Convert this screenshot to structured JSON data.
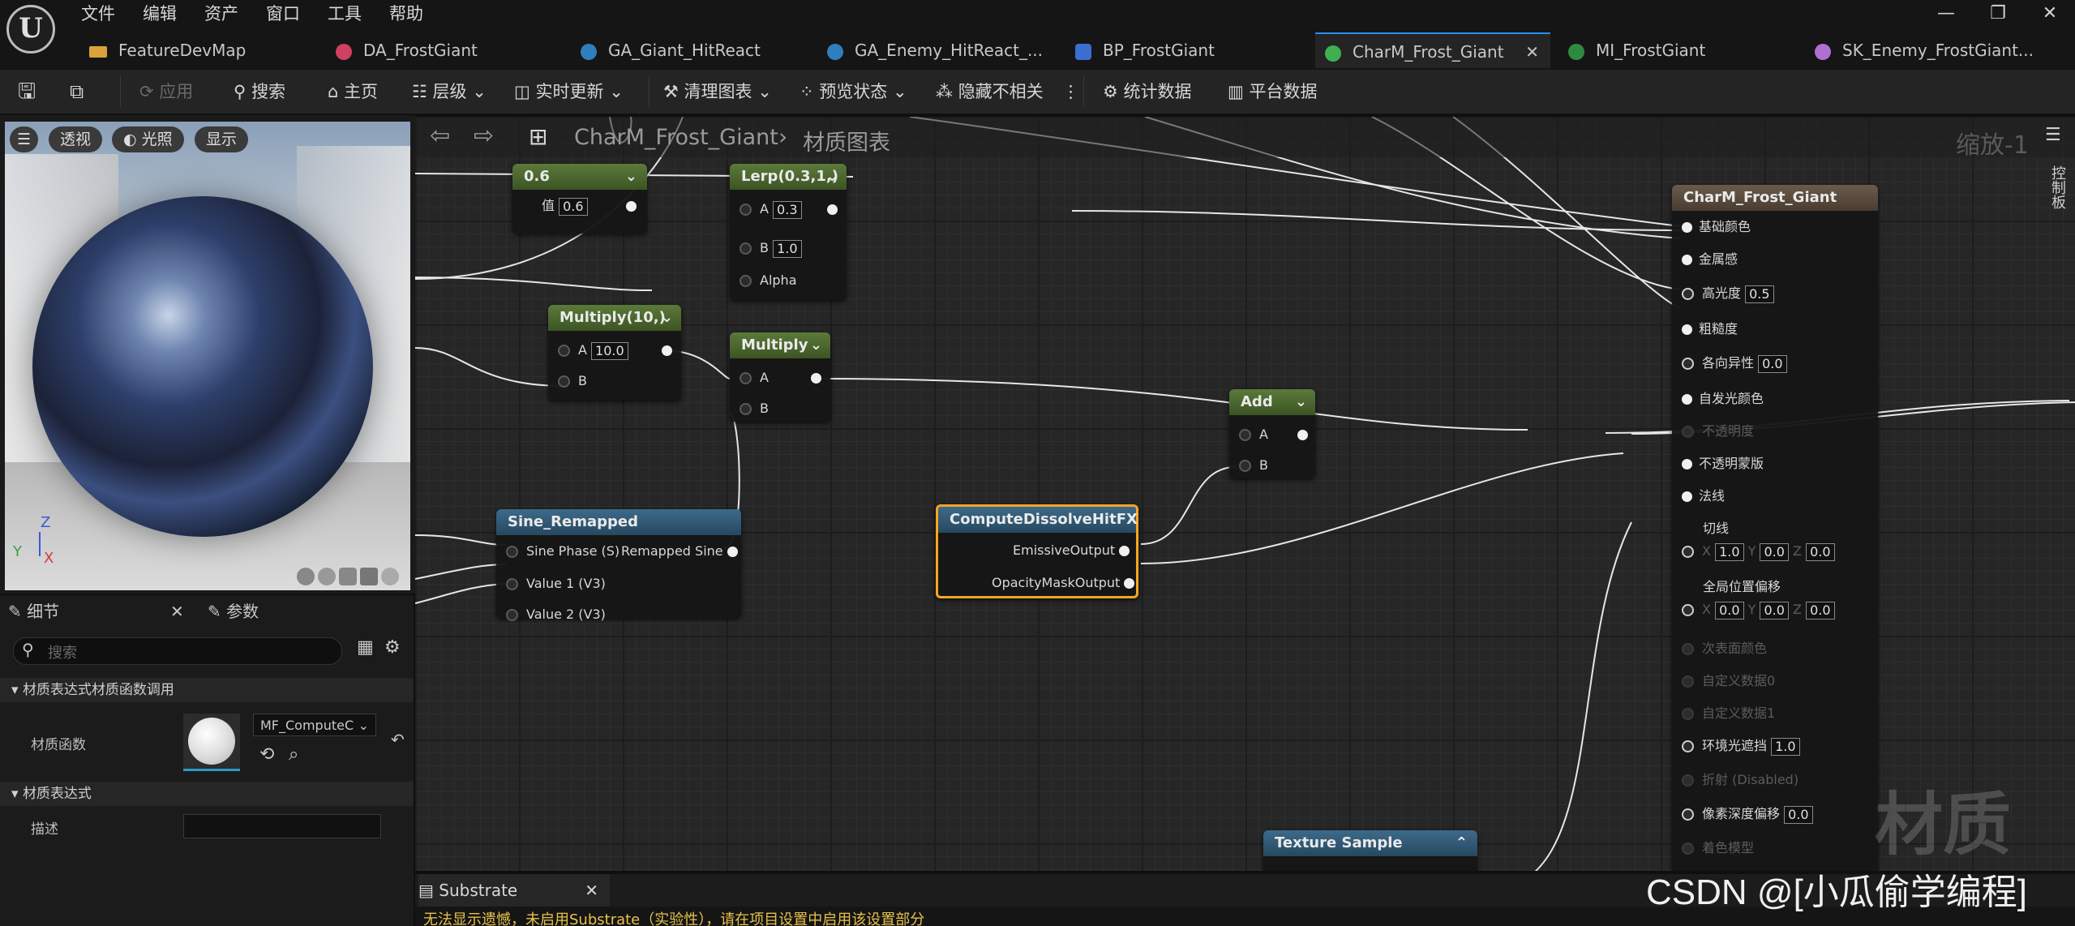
{
  "menu": [
    "文件",
    "编辑",
    "资产",
    "窗口",
    "工具",
    "帮助"
  ],
  "window_controls": [
    "—",
    "❐",
    "✕"
  ],
  "tabs": [
    {
      "label": "FeatureDevMap",
      "color": "#d9a23a"
    },
    {
      "label": "DA_FrostGiant",
      "color": "#d04060"
    },
    {
      "label": "GA_Giant_HitReact",
      "color": "#2f7fc0"
    },
    {
      "label": "GA_Enemy_HitReact_...",
      "color": "#2f7fc0"
    },
    {
      "label": "BP_FrostGiant",
      "color": "#3a6fd0"
    },
    {
      "label": "CharM_Frost_Giant",
      "color": "#3fb050",
      "close": "✕"
    },
    {
      "label": "MI_FrostGiant",
      "color": "#3fb050"
    },
    {
      "label": "SK_Enemy_FrostGiant...",
      "color": "#b070d0"
    }
  ],
  "toolbar": {
    "apply": "应用",
    "search": "搜索",
    "home": "主页",
    "hierarchy": "层级",
    "live_update": "实时更新",
    "clean_graph": "清理图表",
    "preview_state": "预览状态",
    "hide_unrelated": "隐藏不相关",
    "stats": "统计数据",
    "platform_stats": "平台数据"
  },
  "viewport": {
    "perspective": "透视",
    "lit": "光照",
    "show": "显示",
    "axis_x": "X",
    "axis_y": "Y",
    "axis_z": "Z"
  },
  "details": {
    "tab_details": "细节",
    "tab_params": "参数",
    "search_placeholder": "搜索",
    "section1": "材质表达式材质函数调用",
    "prop_function": "材质函数",
    "function_value": "MF_ComputeC",
    "section2": "材质表达式",
    "prop_desc": "描述"
  },
  "graph": {
    "breadcrumb_asset": "CharM_Frost_Giant",
    "breadcrumb_sep": "›",
    "breadcrumb_page": "材质图表",
    "zoom": "缩放-1",
    "side_tab": "控制板",
    "watermark": "材质",
    "credit": "CSDN @[小瓜偷学编程]",
    "nodes": {
      "const": {
        "title": "0.6",
        "pin": "值",
        "value": "0.6"
      },
      "lerp": {
        "title": "Lerp(0.3,1,)",
        "a": "A",
        "a_val": "0.3",
        "b": "B",
        "b_val": "1.0",
        "alpha": "Alpha"
      },
      "mul10": {
        "title": "Multiply(10,)",
        "a": "A",
        "a_val": "10.0",
        "b": "B"
      },
      "mul": {
        "title": "Multiply",
        "a": "A",
        "b": "B"
      },
      "add": {
        "title": "Add",
        "a": "A",
        "b": "B"
      },
      "sine": {
        "title": "Sine_Remapped",
        "p1": "Sine Phase (S)",
        "out": "Remapped Sine",
        "p2": "Value 1 (V3)",
        "p3": "Value 2 (V3)"
      },
      "dissolve": {
        "title": "ComputeDissolveHitFX",
        "out1": "EmissiveOutput",
        "out2": "OpacityMaskOutput"
      },
      "tex": {
        "title": "Texture Sample"
      },
      "result": {
        "title": "CharM_Frost_Giant",
        "base_color": "基础颜色",
        "metallic": "金属感",
        "specular": "高光度",
        "specular_val": "0.5",
        "roughness": "粗糙度",
        "anisotropy": "各向异性",
        "anisotropy_val": "0.0",
        "emissive": "自发光颜色",
        "opacity": "不透明度",
        "opacity_mask": "不透明蒙版",
        "normal": "法线",
        "tangent": "切线",
        "tx": "1.0",
        "ty": "0.0",
        "tz": "0.0",
        "wpo": "全局位置偏移",
        "wx": "0.0",
        "wy": "0.0",
        "wz": "0.0",
        "subsurface": "次表面颜色",
        "custom0": "自定义数据0",
        "custom1": "自定义数据1",
        "ao": "环境光遮挡",
        "ao_val": "1.0",
        "refraction": "折射 (Disabled)",
        "pdo": "像素深度偏移",
        "pdo_val": "0.0",
        "shading_model": "着色模型"
      }
    },
    "labels": {
      "x": "X",
      "y": "Y",
      "z": "Z"
    }
  },
  "bottom": {
    "substrate_tab": "Substrate",
    "substrate_close": "✕",
    "warning": "无法显示遗憾，未启用Substrate（实验性），请在项目设置中启用该设置部分"
  }
}
